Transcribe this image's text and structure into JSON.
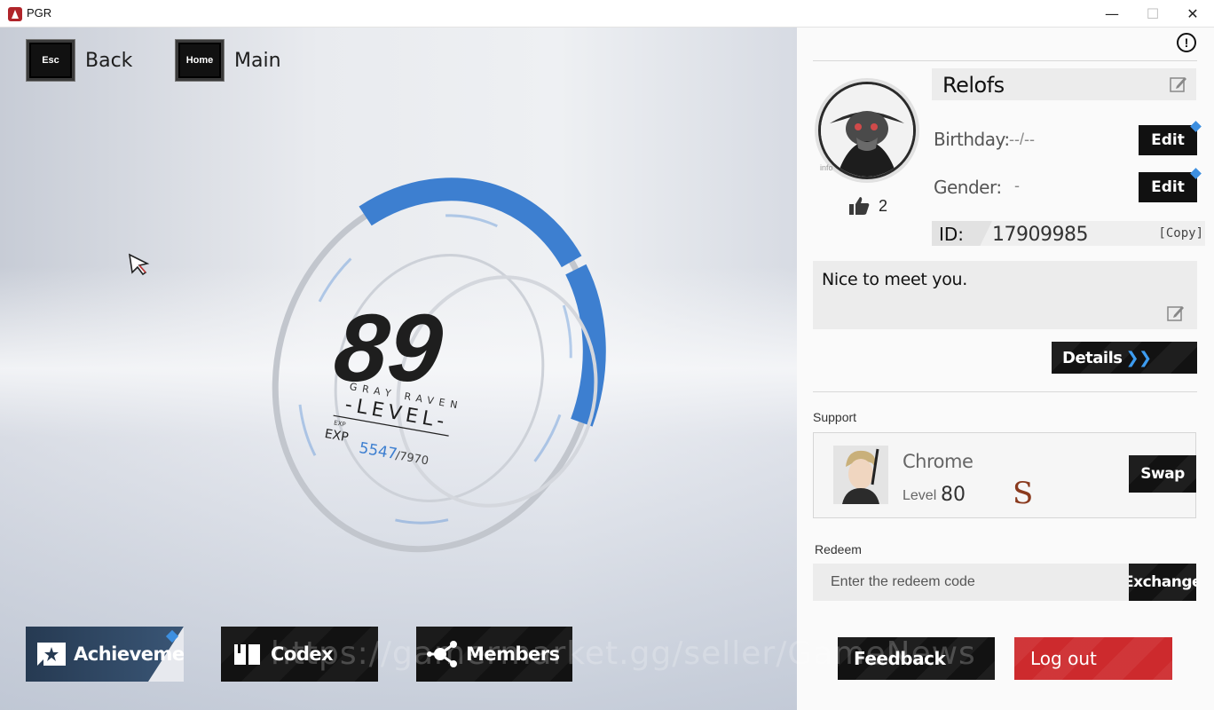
{
  "window": {
    "title": "PGR",
    "minimize": "—",
    "maximize": "☐",
    "close": "✕"
  },
  "nav": {
    "back_key": "Esc",
    "back_label": "Back",
    "home_key": "Home",
    "home_label": "Main"
  },
  "level": {
    "value": "89",
    "brand": "GRAY RAVEN",
    "label": "-LEVEL-",
    "exp_small": "EXP",
    "exp_label": "EXP",
    "exp_current": "5547",
    "exp_total": "/7970",
    "exp_progress": 0.696
  },
  "bottom_buttons": {
    "achievements": "Achievements",
    "codex": "Codex",
    "members": "Members"
  },
  "watermark": "https://gamermarket.gg/seller/GameNews",
  "profile": {
    "name": "Relofs",
    "avatar_caption": "info",
    "likes": "2",
    "birthday_label": "Birthday:",
    "birthday_value": "--/--",
    "gender_label": "Gender:",
    "gender_value": "-",
    "edit_label": "Edit",
    "id_label": "ID:",
    "id_value": "17909985",
    "copy_label": "[Copy]",
    "signature": "Nice to meet you.",
    "details_label": "Details",
    "details_arrows": "❯❯"
  },
  "support": {
    "section_label": "Support",
    "character_name": "Chrome",
    "level_label": "Level",
    "level_value": "80",
    "rank": "S",
    "swap_label": "Swap"
  },
  "redeem": {
    "section_label": "Redeem",
    "placeholder": "Enter the redeem code",
    "exchange_label": "Exchange"
  },
  "footer": {
    "feedback_label": "Feedback",
    "logout_label": "Log out"
  },
  "colors": {
    "accent_blue": "#3d7fd0",
    "logout_red": "#cd2a2d",
    "dark_button": "#121212"
  }
}
